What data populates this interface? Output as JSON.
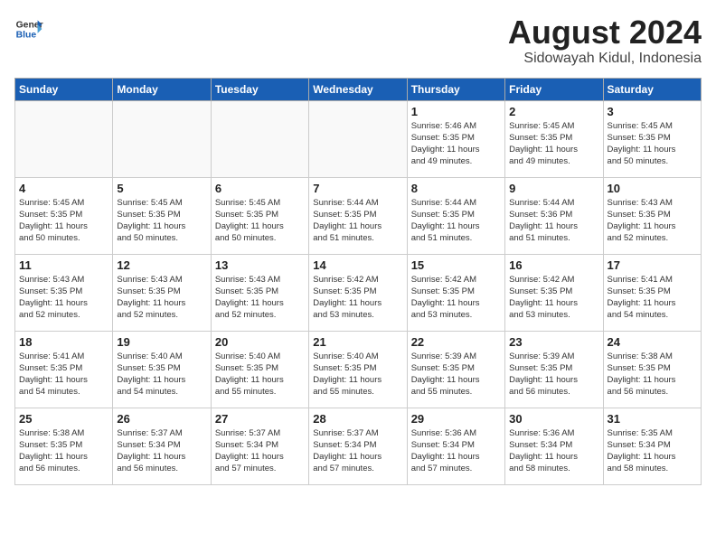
{
  "header": {
    "logo_line1": "General",
    "logo_line2": "Blue",
    "month_year": "August 2024",
    "location": "Sidowayah Kidul, Indonesia"
  },
  "weekdays": [
    "Sunday",
    "Monday",
    "Tuesday",
    "Wednesday",
    "Thursday",
    "Friday",
    "Saturday"
  ],
  "weeks": [
    [
      {
        "day": "",
        "info": ""
      },
      {
        "day": "",
        "info": ""
      },
      {
        "day": "",
        "info": ""
      },
      {
        "day": "",
        "info": ""
      },
      {
        "day": "1",
        "info": "Sunrise: 5:46 AM\nSunset: 5:35 PM\nDaylight: 11 hours\nand 49 minutes."
      },
      {
        "day": "2",
        "info": "Sunrise: 5:45 AM\nSunset: 5:35 PM\nDaylight: 11 hours\nand 49 minutes."
      },
      {
        "day": "3",
        "info": "Sunrise: 5:45 AM\nSunset: 5:35 PM\nDaylight: 11 hours\nand 50 minutes."
      }
    ],
    [
      {
        "day": "4",
        "info": "Sunrise: 5:45 AM\nSunset: 5:35 PM\nDaylight: 11 hours\nand 50 minutes."
      },
      {
        "day": "5",
        "info": "Sunrise: 5:45 AM\nSunset: 5:35 PM\nDaylight: 11 hours\nand 50 minutes."
      },
      {
        "day": "6",
        "info": "Sunrise: 5:45 AM\nSunset: 5:35 PM\nDaylight: 11 hours\nand 50 minutes."
      },
      {
        "day": "7",
        "info": "Sunrise: 5:44 AM\nSunset: 5:35 PM\nDaylight: 11 hours\nand 51 minutes."
      },
      {
        "day": "8",
        "info": "Sunrise: 5:44 AM\nSunset: 5:35 PM\nDaylight: 11 hours\nand 51 minutes."
      },
      {
        "day": "9",
        "info": "Sunrise: 5:44 AM\nSunset: 5:36 PM\nDaylight: 11 hours\nand 51 minutes."
      },
      {
        "day": "10",
        "info": "Sunrise: 5:43 AM\nSunset: 5:35 PM\nDaylight: 11 hours\nand 52 minutes."
      }
    ],
    [
      {
        "day": "11",
        "info": "Sunrise: 5:43 AM\nSunset: 5:35 PM\nDaylight: 11 hours\nand 52 minutes."
      },
      {
        "day": "12",
        "info": "Sunrise: 5:43 AM\nSunset: 5:35 PM\nDaylight: 11 hours\nand 52 minutes."
      },
      {
        "day": "13",
        "info": "Sunrise: 5:43 AM\nSunset: 5:35 PM\nDaylight: 11 hours\nand 52 minutes."
      },
      {
        "day": "14",
        "info": "Sunrise: 5:42 AM\nSunset: 5:35 PM\nDaylight: 11 hours\nand 53 minutes."
      },
      {
        "day": "15",
        "info": "Sunrise: 5:42 AM\nSunset: 5:35 PM\nDaylight: 11 hours\nand 53 minutes."
      },
      {
        "day": "16",
        "info": "Sunrise: 5:42 AM\nSunset: 5:35 PM\nDaylight: 11 hours\nand 53 minutes."
      },
      {
        "day": "17",
        "info": "Sunrise: 5:41 AM\nSunset: 5:35 PM\nDaylight: 11 hours\nand 54 minutes."
      }
    ],
    [
      {
        "day": "18",
        "info": "Sunrise: 5:41 AM\nSunset: 5:35 PM\nDaylight: 11 hours\nand 54 minutes."
      },
      {
        "day": "19",
        "info": "Sunrise: 5:40 AM\nSunset: 5:35 PM\nDaylight: 11 hours\nand 54 minutes."
      },
      {
        "day": "20",
        "info": "Sunrise: 5:40 AM\nSunset: 5:35 PM\nDaylight: 11 hours\nand 55 minutes."
      },
      {
        "day": "21",
        "info": "Sunrise: 5:40 AM\nSunset: 5:35 PM\nDaylight: 11 hours\nand 55 minutes."
      },
      {
        "day": "22",
        "info": "Sunrise: 5:39 AM\nSunset: 5:35 PM\nDaylight: 11 hours\nand 55 minutes."
      },
      {
        "day": "23",
        "info": "Sunrise: 5:39 AM\nSunset: 5:35 PM\nDaylight: 11 hours\nand 56 minutes."
      },
      {
        "day": "24",
        "info": "Sunrise: 5:38 AM\nSunset: 5:35 PM\nDaylight: 11 hours\nand 56 minutes."
      }
    ],
    [
      {
        "day": "25",
        "info": "Sunrise: 5:38 AM\nSunset: 5:35 PM\nDaylight: 11 hours\nand 56 minutes."
      },
      {
        "day": "26",
        "info": "Sunrise: 5:37 AM\nSunset: 5:34 PM\nDaylight: 11 hours\nand 56 minutes."
      },
      {
        "day": "27",
        "info": "Sunrise: 5:37 AM\nSunset: 5:34 PM\nDaylight: 11 hours\nand 57 minutes."
      },
      {
        "day": "28",
        "info": "Sunrise: 5:37 AM\nSunset: 5:34 PM\nDaylight: 11 hours\nand 57 minutes."
      },
      {
        "day": "29",
        "info": "Sunrise: 5:36 AM\nSunset: 5:34 PM\nDaylight: 11 hours\nand 57 minutes."
      },
      {
        "day": "30",
        "info": "Sunrise: 5:36 AM\nSunset: 5:34 PM\nDaylight: 11 hours\nand 58 minutes."
      },
      {
        "day": "31",
        "info": "Sunrise: 5:35 AM\nSunset: 5:34 PM\nDaylight: 11 hours\nand 58 minutes."
      }
    ]
  ]
}
